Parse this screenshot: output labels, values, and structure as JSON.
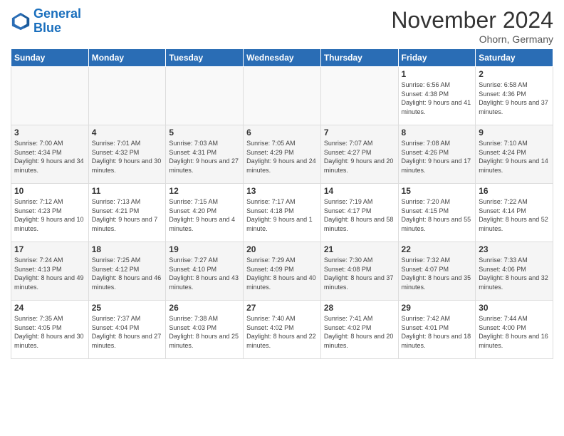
{
  "header": {
    "logo_line1": "General",
    "logo_line2": "Blue",
    "month": "November 2024",
    "location": "Ohorn, Germany"
  },
  "days_of_week": [
    "Sunday",
    "Monday",
    "Tuesday",
    "Wednesday",
    "Thursday",
    "Friday",
    "Saturday"
  ],
  "weeks": [
    [
      {
        "day": "",
        "detail": ""
      },
      {
        "day": "",
        "detail": ""
      },
      {
        "day": "",
        "detail": ""
      },
      {
        "day": "",
        "detail": ""
      },
      {
        "day": "",
        "detail": ""
      },
      {
        "day": "1",
        "detail": "Sunrise: 6:56 AM\nSunset: 4:38 PM\nDaylight: 9 hours and 41 minutes."
      },
      {
        "day": "2",
        "detail": "Sunrise: 6:58 AM\nSunset: 4:36 PM\nDaylight: 9 hours and 37 minutes."
      }
    ],
    [
      {
        "day": "3",
        "detail": "Sunrise: 7:00 AM\nSunset: 4:34 PM\nDaylight: 9 hours and 34 minutes."
      },
      {
        "day": "4",
        "detail": "Sunrise: 7:01 AM\nSunset: 4:32 PM\nDaylight: 9 hours and 30 minutes."
      },
      {
        "day": "5",
        "detail": "Sunrise: 7:03 AM\nSunset: 4:31 PM\nDaylight: 9 hours and 27 minutes."
      },
      {
        "day": "6",
        "detail": "Sunrise: 7:05 AM\nSunset: 4:29 PM\nDaylight: 9 hours and 24 minutes."
      },
      {
        "day": "7",
        "detail": "Sunrise: 7:07 AM\nSunset: 4:27 PM\nDaylight: 9 hours and 20 minutes."
      },
      {
        "day": "8",
        "detail": "Sunrise: 7:08 AM\nSunset: 4:26 PM\nDaylight: 9 hours and 17 minutes."
      },
      {
        "day": "9",
        "detail": "Sunrise: 7:10 AM\nSunset: 4:24 PM\nDaylight: 9 hours and 14 minutes."
      }
    ],
    [
      {
        "day": "10",
        "detail": "Sunrise: 7:12 AM\nSunset: 4:23 PM\nDaylight: 9 hours and 10 minutes."
      },
      {
        "day": "11",
        "detail": "Sunrise: 7:13 AM\nSunset: 4:21 PM\nDaylight: 9 hours and 7 minutes."
      },
      {
        "day": "12",
        "detail": "Sunrise: 7:15 AM\nSunset: 4:20 PM\nDaylight: 9 hours and 4 minutes."
      },
      {
        "day": "13",
        "detail": "Sunrise: 7:17 AM\nSunset: 4:18 PM\nDaylight: 9 hours and 1 minute."
      },
      {
        "day": "14",
        "detail": "Sunrise: 7:19 AM\nSunset: 4:17 PM\nDaylight: 8 hours and 58 minutes."
      },
      {
        "day": "15",
        "detail": "Sunrise: 7:20 AM\nSunset: 4:15 PM\nDaylight: 8 hours and 55 minutes."
      },
      {
        "day": "16",
        "detail": "Sunrise: 7:22 AM\nSunset: 4:14 PM\nDaylight: 8 hours and 52 minutes."
      }
    ],
    [
      {
        "day": "17",
        "detail": "Sunrise: 7:24 AM\nSunset: 4:13 PM\nDaylight: 8 hours and 49 minutes."
      },
      {
        "day": "18",
        "detail": "Sunrise: 7:25 AM\nSunset: 4:12 PM\nDaylight: 8 hours and 46 minutes."
      },
      {
        "day": "19",
        "detail": "Sunrise: 7:27 AM\nSunset: 4:10 PM\nDaylight: 8 hours and 43 minutes."
      },
      {
        "day": "20",
        "detail": "Sunrise: 7:29 AM\nSunset: 4:09 PM\nDaylight: 8 hours and 40 minutes."
      },
      {
        "day": "21",
        "detail": "Sunrise: 7:30 AM\nSunset: 4:08 PM\nDaylight: 8 hours and 37 minutes."
      },
      {
        "day": "22",
        "detail": "Sunrise: 7:32 AM\nSunset: 4:07 PM\nDaylight: 8 hours and 35 minutes."
      },
      {
        "day": "23",
        "detail": "Sunrise: 7:33 AM\nSunset: 4:06 PM\nDaylight: 8 hours and 32 minutes."
      }
    ],
    [
      {
        "day": "24",
        "detail": "Sunrise: 7:35 AM\nSunset: 4:05 PM\nDaylight: 8 hours and 30 minutes."
      },
      {
        "day": "25",
        "detail": "Sunrise: 7:37 AM\nSunset: 4:04 PM\nDaylight: 8 hours and 27 minutes."
      },
      {
        "day": "26",
        "detail": "Sunrise: 7:38 AM\nSunset: 4:03 PM\nDaylight: 8 hours and 25 minutes."
      },
      {
        "day": "27",
        "detail": "Sunrise: 7:40 AM\nSunset: 4:02 PM\nDaylight: 8 hours and 22 minutes."
      },
      {
        "day": "28",
        "detail": "Sunrise: 7:41 AM\nSunset: 4:02 PM\nDaylight: 8 hours and 20 minutes."
      },
      {
        "day": "29",
        "detail": "Sunrise: 7:42 AM\nSunset: 4:01 PM\nDaylight: 8 hours and 18 minutes."
      },
      {
        "day": "30",
        "detail": "Sunrise: 7:44 AM\nSunset: 4:00 PM\nDaylight: 8 hours and 16 minutes."
      }
    ]
  ]
}
